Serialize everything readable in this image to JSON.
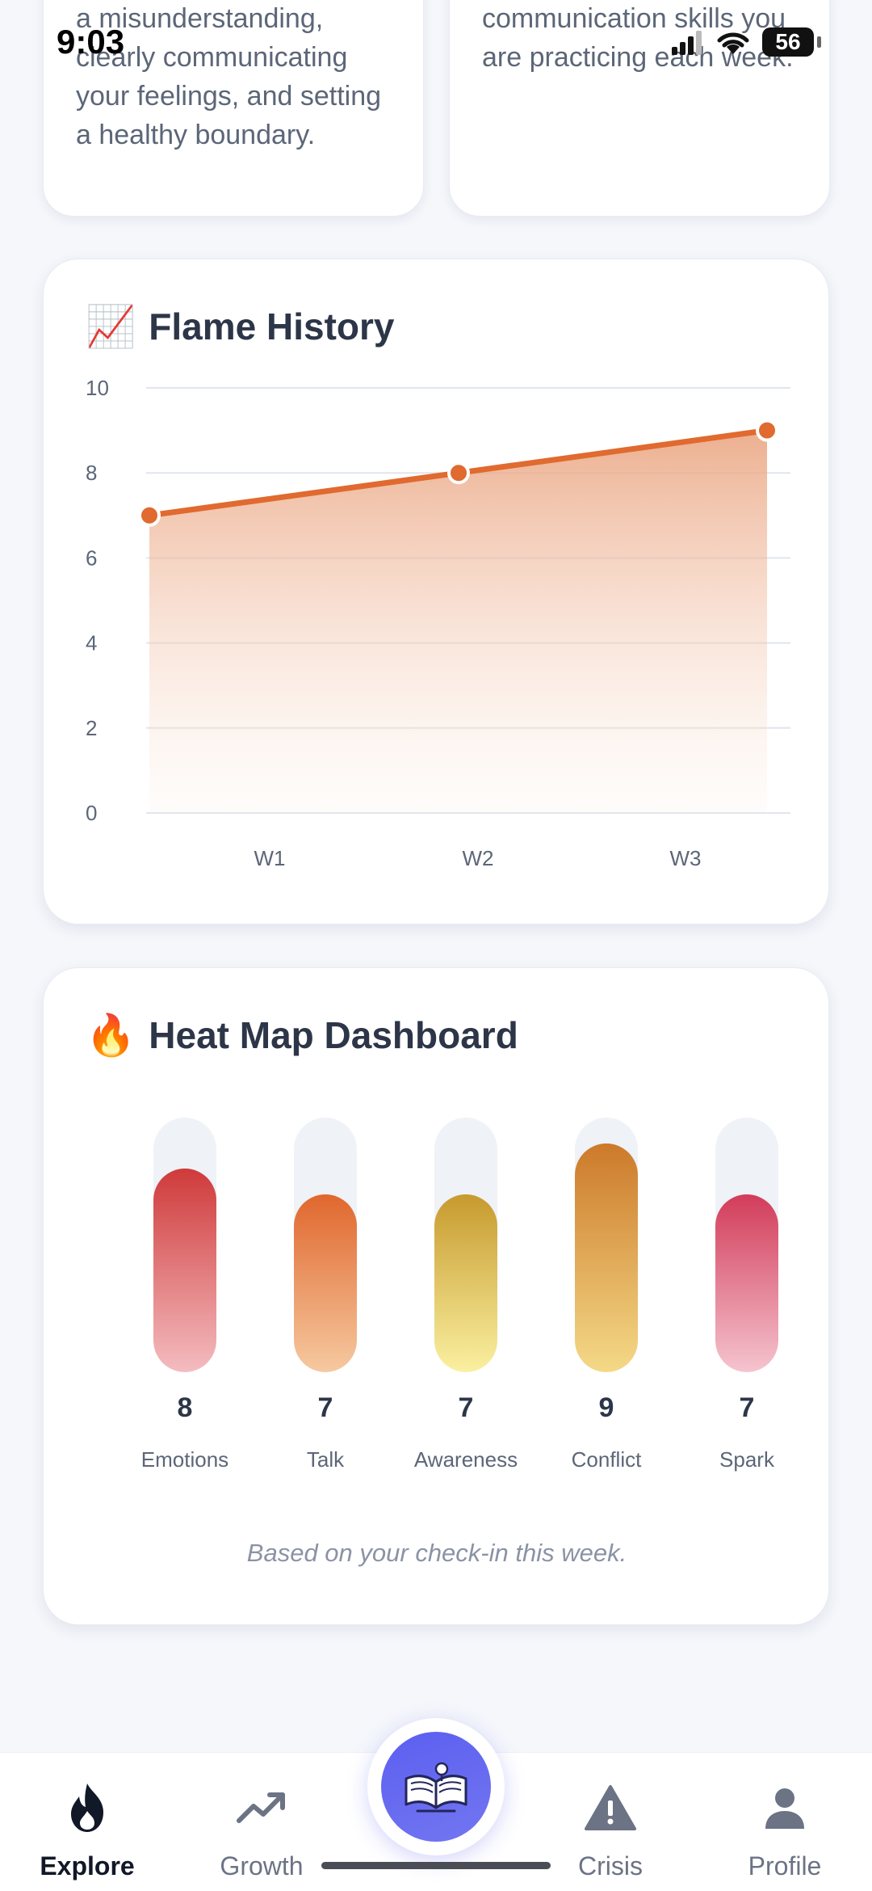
{
  "status_bar": {
    "time": "9:03",
    "battery": "56"
  },
  "top_cards": {
    "left_text": "a misunderstanding, clearly communicating your feelings, and setting a healthy boundary.",
    "right_text": "communication skills you are practicing each week."
  },
  "flame_history": {
    "emoji": "📈",
    "title": "Flame History",
    "chart_data": {
      "type": "area",
      "categories": [
        "W1",
        "W2",
        "W3"
      ],
      "values": [
        7,
        8,
        9
      ],
      "ylim": [
        0,
        10
      ],
      "yticks": [
        0,
        2,
        4,
        6,
        8,
        10
      ],
      "grid": true,
      "line_color": "#e06a2f",
      "fill_color": "#e9a17c"
    }
  },
  "heat_map": {
    "emoji": "🔥",
    "title": "Heat Map Dashboard",
    "note": "Based on your check-in this week.",
    "chart_data": {
      "type": "bar",
      "categories": [
        "Emotions",
        "Talk",
        "Awareness",
        "Conflict",
        "Spark"
      ],
      "values": [
        8,
        7,
        7,
        9,
        7
      ],
      "ylim": [
        0,
        10
      ],
      "colors": [
        {
          "top": "#cf3a3a",
          "bottom": "#f4bcc0"
        },
        {
          "top": "#e0672e",
          "bottom": "#f6c9a0"
        },
        {
          "top": "#c79a2e",
          "bottom": "#faf0a0"
        },
        {
          "top": "#cc7a2a",
          "bottom": "#f4d987"
        },
        {
          "top": "#d23c5a",
          "bottom": "#f5c4cf"
        }
      ]
    }
  },
  "bottom_nav": {
    "items": [
      {
        "label": "Explore",
        "icon": "flame-icon",
        "active": true
      },
      {
        "label": "Growth",
        "icon": "trending-up-icon",
        "active": false
      },
      {
        "label": "Crisis",
        "icon": "warning-icon",
        "active": false
      },
      {
        "label": "Profile",
        "icon": "person-icon",
        "active": false
      }
    ],
    "center_button_icon": "open-book-icon",
    "accent": "#6366f1"
  }
}
